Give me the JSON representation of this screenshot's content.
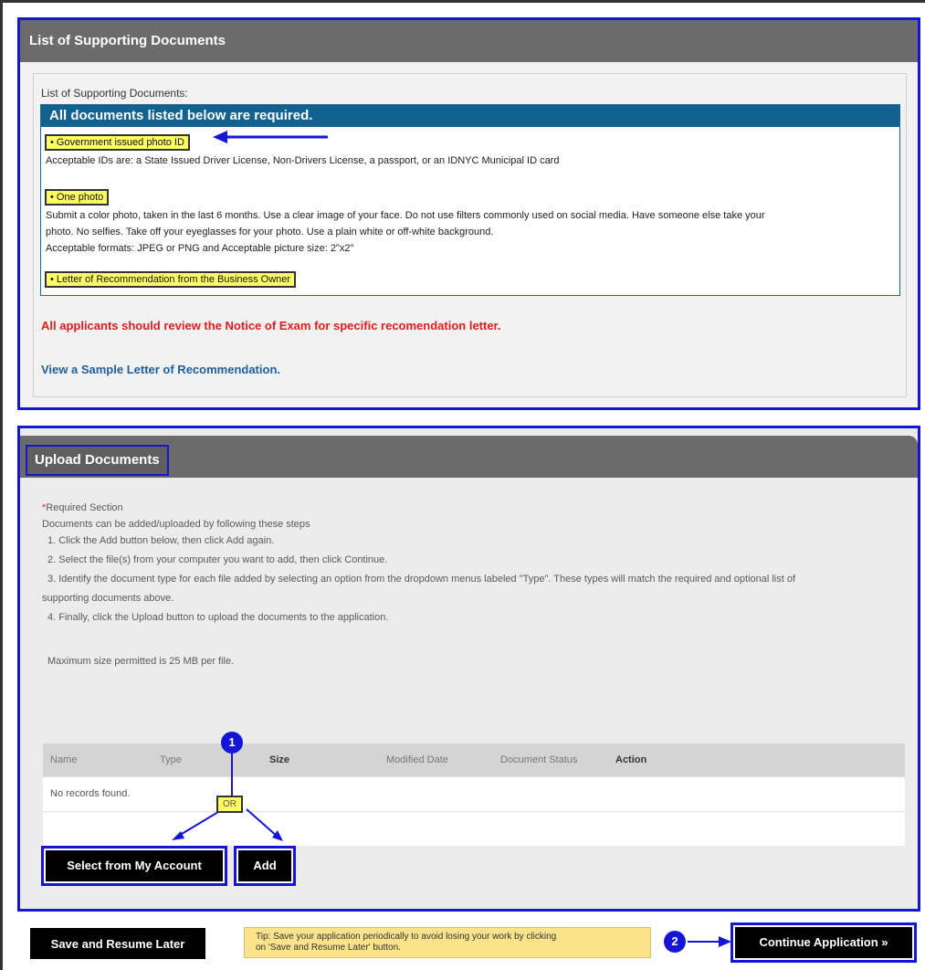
{
  "supporting_docs": {
    "panel_title": "List of Supporting Documents",
    "list_label": "List of Supporting Documents:",
    "box_header": "All documents listed below are required.",
    "items": [
      {
        "tag": "• Government issued photo ID",
        "description": [
          "Acceptable IDs are: a State Issued Driver License, Non-Drivers License, a passport, or an IDNYC Municipal ID card"
        ]
      },
      {
        "tag": "• One photo",
        "description": [
          "Submit a color photo, taken in the last 6 months. Use a clear image of your face. Do not use filters commonly used on social media. Have someone else take your",
          "photo. No selfies. Take off your eyeglasses for your photo. Use a plain white or off-white background.",
          "Acceptable formats: JPEG or PNG and Acceptable picture size: 2\"x2\""
        ]
      },
      {
        "tag": "• Letter of Recommendation from the Business Owner",
        "description": []
      }
    ],
    "notice": "All applicants should review the Notice of Exam for specific recomendation letter.",
    "sample_link": "View a Sample Letter of Recommendation."
  },
  "upload": {
    "panel_title": "Upload Documents",
    "required_star": "*",
    "required_label": "Required Section",
    "intro": "Documents can be added/uploaded by following these steps",
    "steps": [
      "1. Click the Add button below, then click Add again.",
      "2. Select the file(s) from your computer you want to add, then click Continue.",
      "3. Identify the document type for each file added by selecting an option from the dropdown menus labeled \"Type\". These types will match the required and optional list of",
      "supporting documents above.",
      "4. Finally, click the Upload button to upload the documents to the application."
    ],
    "max_size": "Maximum size permitted is 25 MB per file.",
    "table": {
      "columns": [
        "Name",
        "Type",
        "Size",
        "Modified Date",
        "Document Status",
        "Action"
      ],
      "empty_message": "No records found."
    },
    "select_account_label": "Select from My Account",
    "add_label": "Add",
    "or_label": "OR",
    "badge_1": "1"
  },
  "footer": {
    "save_label": "Save and Resume Later",
    "tip_line1": "Tip: Save your application periodically to avoid losing your work by clicking",
    "tip_line2": "on 'Save and Resume Later' button.",
    "badge_2": "2",
    "continue_label": "Continue Application »"
  },
  "colors": {
    "highlight_border": "#1515d6",
    "header_gray": "#6b6b6b",
    "box_header_blue": "#12628f",
    "tag_yellow": "#ffff66",
    "notice_red": "#e01c1c",
    "link_blue": "#1d5f9c",
    "tip_yellow": "#fbe38c"
  }
}
